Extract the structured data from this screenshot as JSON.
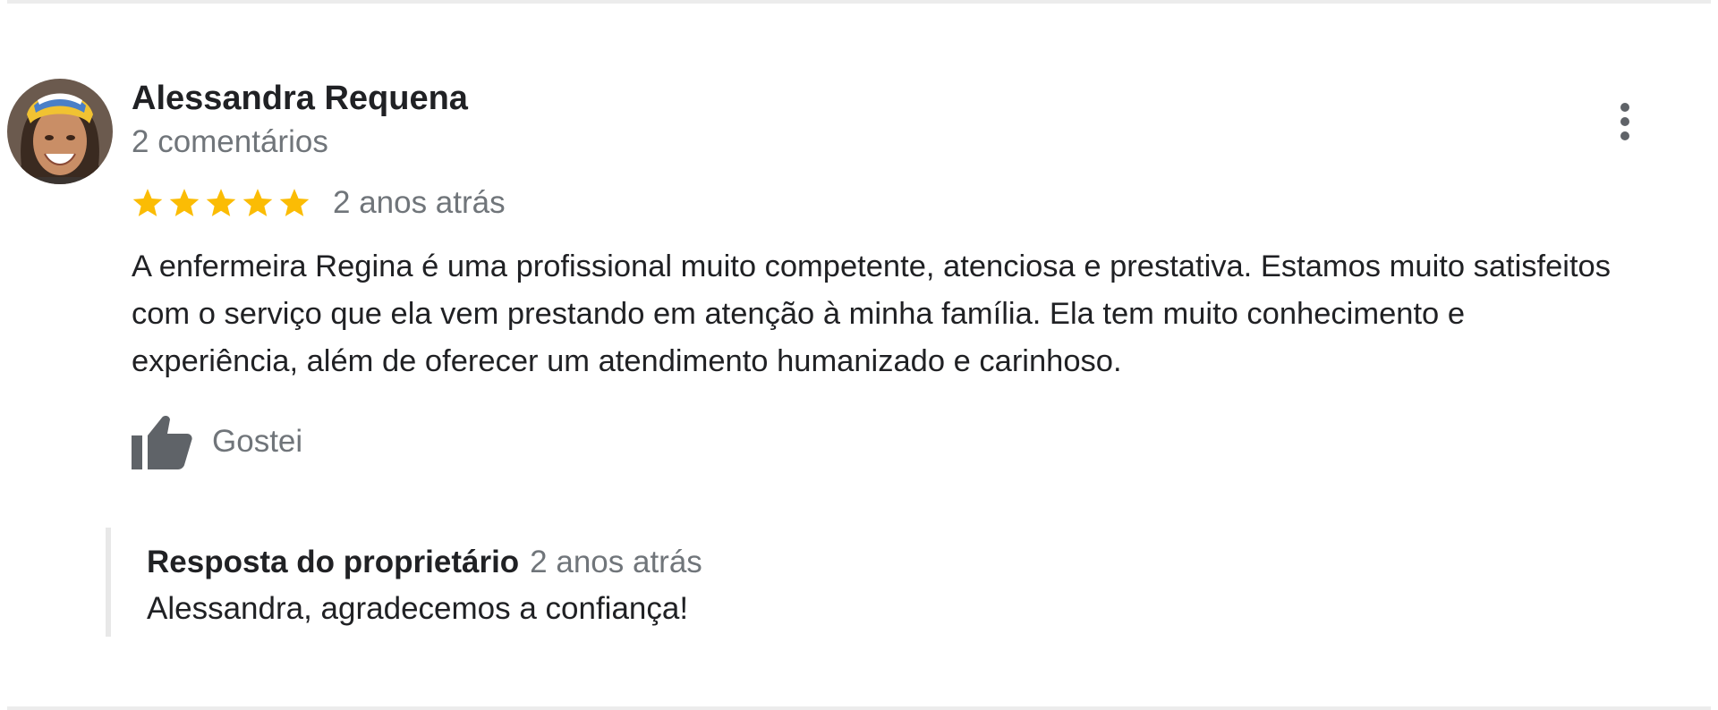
{
  "review": {
    "author": {
      "name": "Alessandra Requena",
      "comment_count": "2 comentários",
      "avatar": "profile-photo"
    },
    "rating": {
      "stars": 5,
      "max": 5,
      "star_color": "#fbbc04"
    },
    "time_ago": "2 anos atrás",
    "text": "A enfermeira Regina é uma profissional muito competente, atenciosa e prestativa. Estamos muito satisfeitos com o serviço que ela vem prestando em atenção à minha família. Ela tem muito conhecimento e experiência, além de oferecer um atendimento humanizado e carinhoso.",
    "like_label": "Gostei",
    "menu_icon": "more-vertical-icon"
  },
  "owner_reply": {
    "title": "Resposta do proprietário",
    "time_ago": "2 anos atrás",
    "text": "Alessandra, agradecemos a confiança!"
  },
  "colors": {
    "text_primary": "#202124",
    "text_secondary": "#70757a",
    "icon_gray": "#5f6368",
    "divider": "#ececec"
  }
}
